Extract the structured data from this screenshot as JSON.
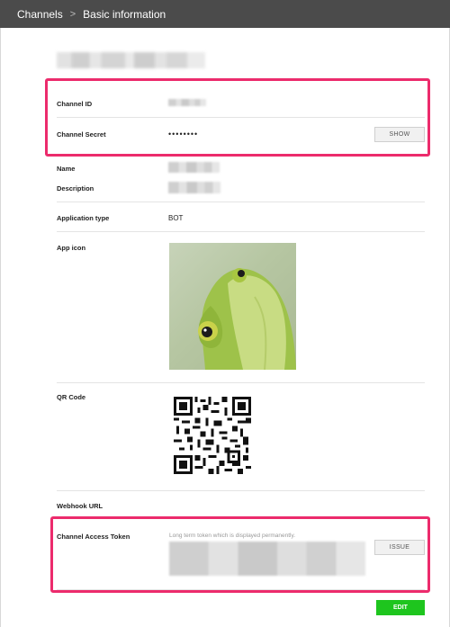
{
  "breadcrumb": {
    "root": "Channels",
    "separator": ">",
    "current": "Basic information"
  },
  "fields": {
    "channel_id_label": "Channel ID",
    "channel_secret_label": "Channel Secret",
    "channel_secret_value": "••••••••",
    "show_button": "SHOW",
    "name_label": "Name",
    "description_label": "Description",
    "application_type_label": "Application type",
    "application_type_value": "BOT",
    "app_icon_label": "App icon",
    "qr_code_label": "QR Code",
    "webhook_url_label": "Webhook URL",
    "channel_access_token_label": "Channel Access Token",
    "token_hint": "Long term token which is displayed permanently.",
    "issue_button": "ISSUE"
  },
  "actions": {
    "edit_button": "EDIT"
  },
  "colors": {
    "topbar": "#4b4b4b",
    "highlight": "#ec2b6c",
    "edit": "#1ec51e"
  },
  "icons": {
    "breadcrumb_separator": "chevron-right-icon",
    "app_icon": "frog-image",
    "qr": "qr-code-image"
  }
}
